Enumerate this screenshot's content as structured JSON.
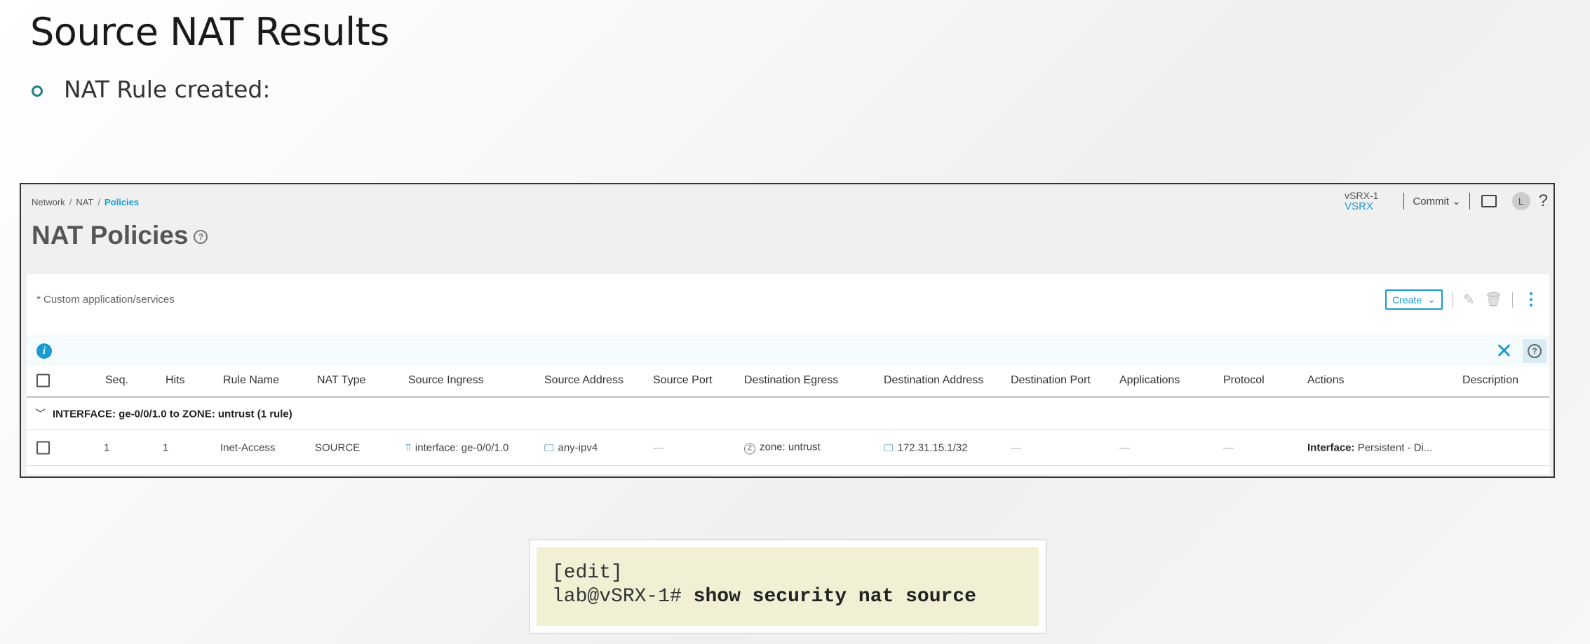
{
  "slide": {
    "title": "Source NAT Results",
    "bullet": "NAT Rule created:"
  },
  "app": {
    "breadcrumb": [
      "Network",
      "NAT",
      "Policies"
    ],
    "page_title": "NAT Policies",
    "device_name": "vSRX-1",
    "device_model": "VSRX",
    "commit_label": "Commit",
    "avatar_letter": "L",
    "help_label": "?",
    "custom_note": "* Custom application/services",
    "create_label": "Create",
    "table": {
      "columns": [
        "Seq.",
        "Hits",
        "Rule Name",
        "NAT Type",
        "Source Ingress",
        "Source Address",
        "Source Port",
        "Destination Egress",
        "Destination Address",
        "Destination Port",
        "Applications",
        "Protocol",
        "Actions",
        "Description"
      ],
      "group": "INTERFACE: ge-0/0/1.0 to ZONE: untrust (1 rule)",
      "rows": [
        {
          "seq": "1",
          "hits": "1",
          "rule_name": "Inet-Access",
          "nat_type": "SOURCE",
          "source_ingress": "interface: ge-0/0/1.0",
          "source_address": "any-ipv4",
          "source_port": "—",
          "destination_egress": "zone: untrust",
          "destination_address": "172.31.15.1/32",
          "destination_port": "—",
          "applications": "—",
          "protocol": "—",
          "actions_label": "Interface:",
          "actions_value": "Persistent - Di...",
          "description": ""
        }
      ]
    }
  },
  "code": {
    "line1": "[edit]",
    "prompt": "lab@vSRX-1#",
    "command": "show security nat source"
  }
}
